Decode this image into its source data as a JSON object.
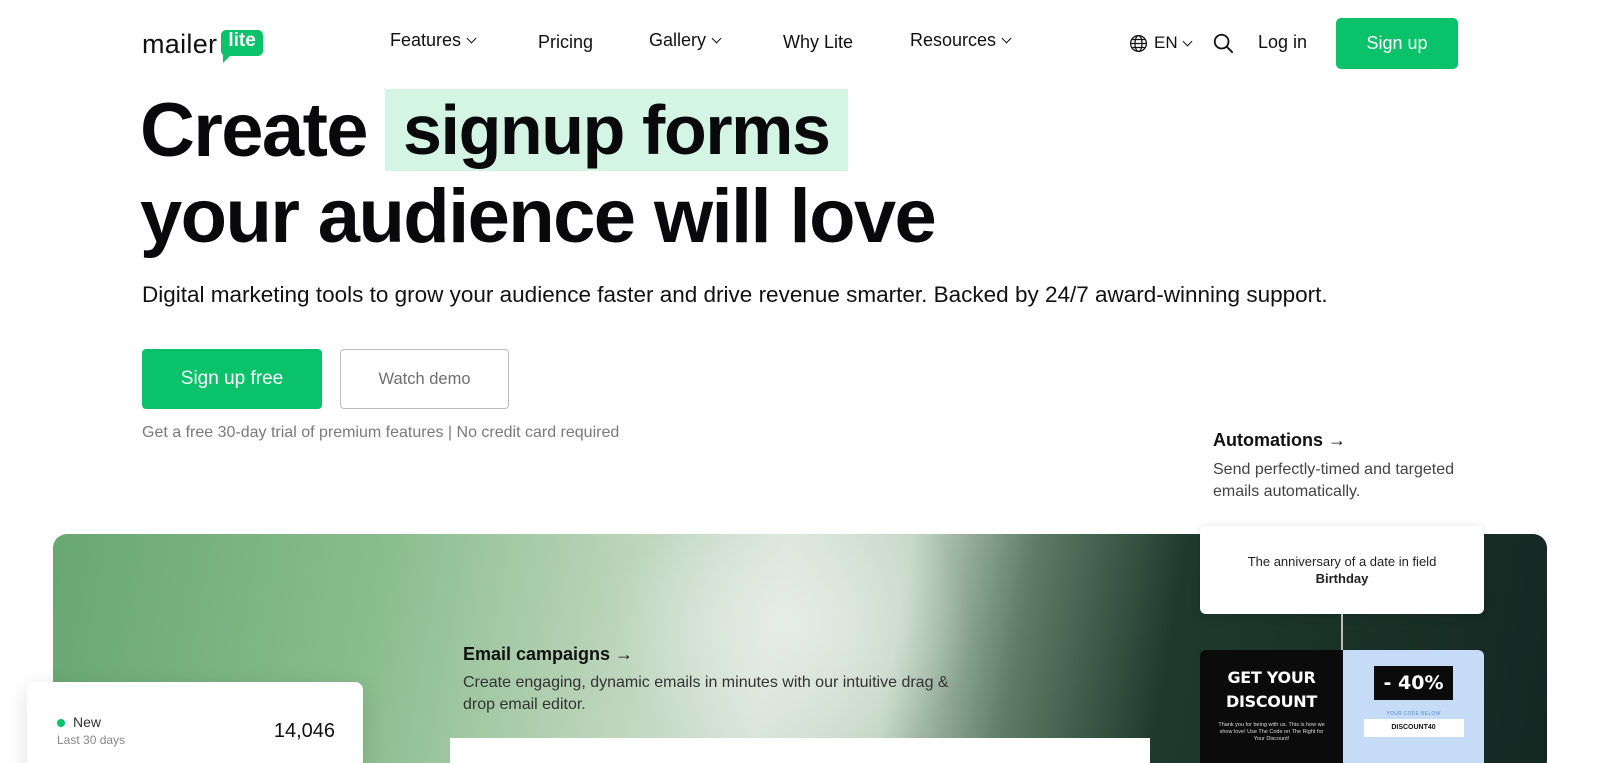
{
  "nav": {
    "logo_word": "mailer",
    "logo_badge": "lite",
    "items": [
      {
        "label": "Features",
        "dropdown": true
      },
      {
        "label": "Pricing",
        "dropdown": false
      },
      {
        "label": "Gallery",
        "dropdown": true
      },
      {
        "label": "Why Lite",
        "dropdown": false
      },
      {
        "label": "Resources",
        "dropdown": true
      }
    ],
    "language": "EN",
    "login": "Log in",
    "signup": "Sign up"
  },
  "hero": {
    "title_word1": "Create",
    "title_highlight": "signup forms",
    "title_line2": "your audience will love",
    "subtitle": "Digital marketing tools to grow your audience faster and drive revenue smarter. Backed by 24/7 award-winning support.",
    "cta_primary": "Sign up free",
    "cta_secondary": "Watch demo",
    "trial_note": "Get a free 30-day trial of premium features | No credit card required"
  },
  "features": {
    "automations": {
      "title": "Automations →",
      "description": "Send perfectly-timed and targeted emails automatically."
    },
    "email_campaigns": {
      "title": "Email campaigns →",
      "description": "Create engaging, dynamic emails in minutes with our intuitive drag & drop email editor."
    }
  },
  "stats_card": {
    "label": "New",
    "sublabel": "Last 30 days",
    "value": "14,046"
  },
  "trigger_card": {
    "text_prefix": "The anniversary of a date in field ",
    "text_bold": "Birthday"
  },
  "discount_card": {
    "headline_1": "GET YOUR",
    "headline_2": "DISCOUNT",
    "body": "Thank you for being with us. This is how we show love! Use The Code on The Right for Your Discount!",
    "percent": "- 40%",
    "code_label": "YOUR CODE BELOW",
    "code": "DISCOUNT40"
  },
  "colors": {
    "brand_green": "#09c269",
    "highlight": "#d4f5e4",
    "discount_blue": "#c6dcf6"
  }
}
